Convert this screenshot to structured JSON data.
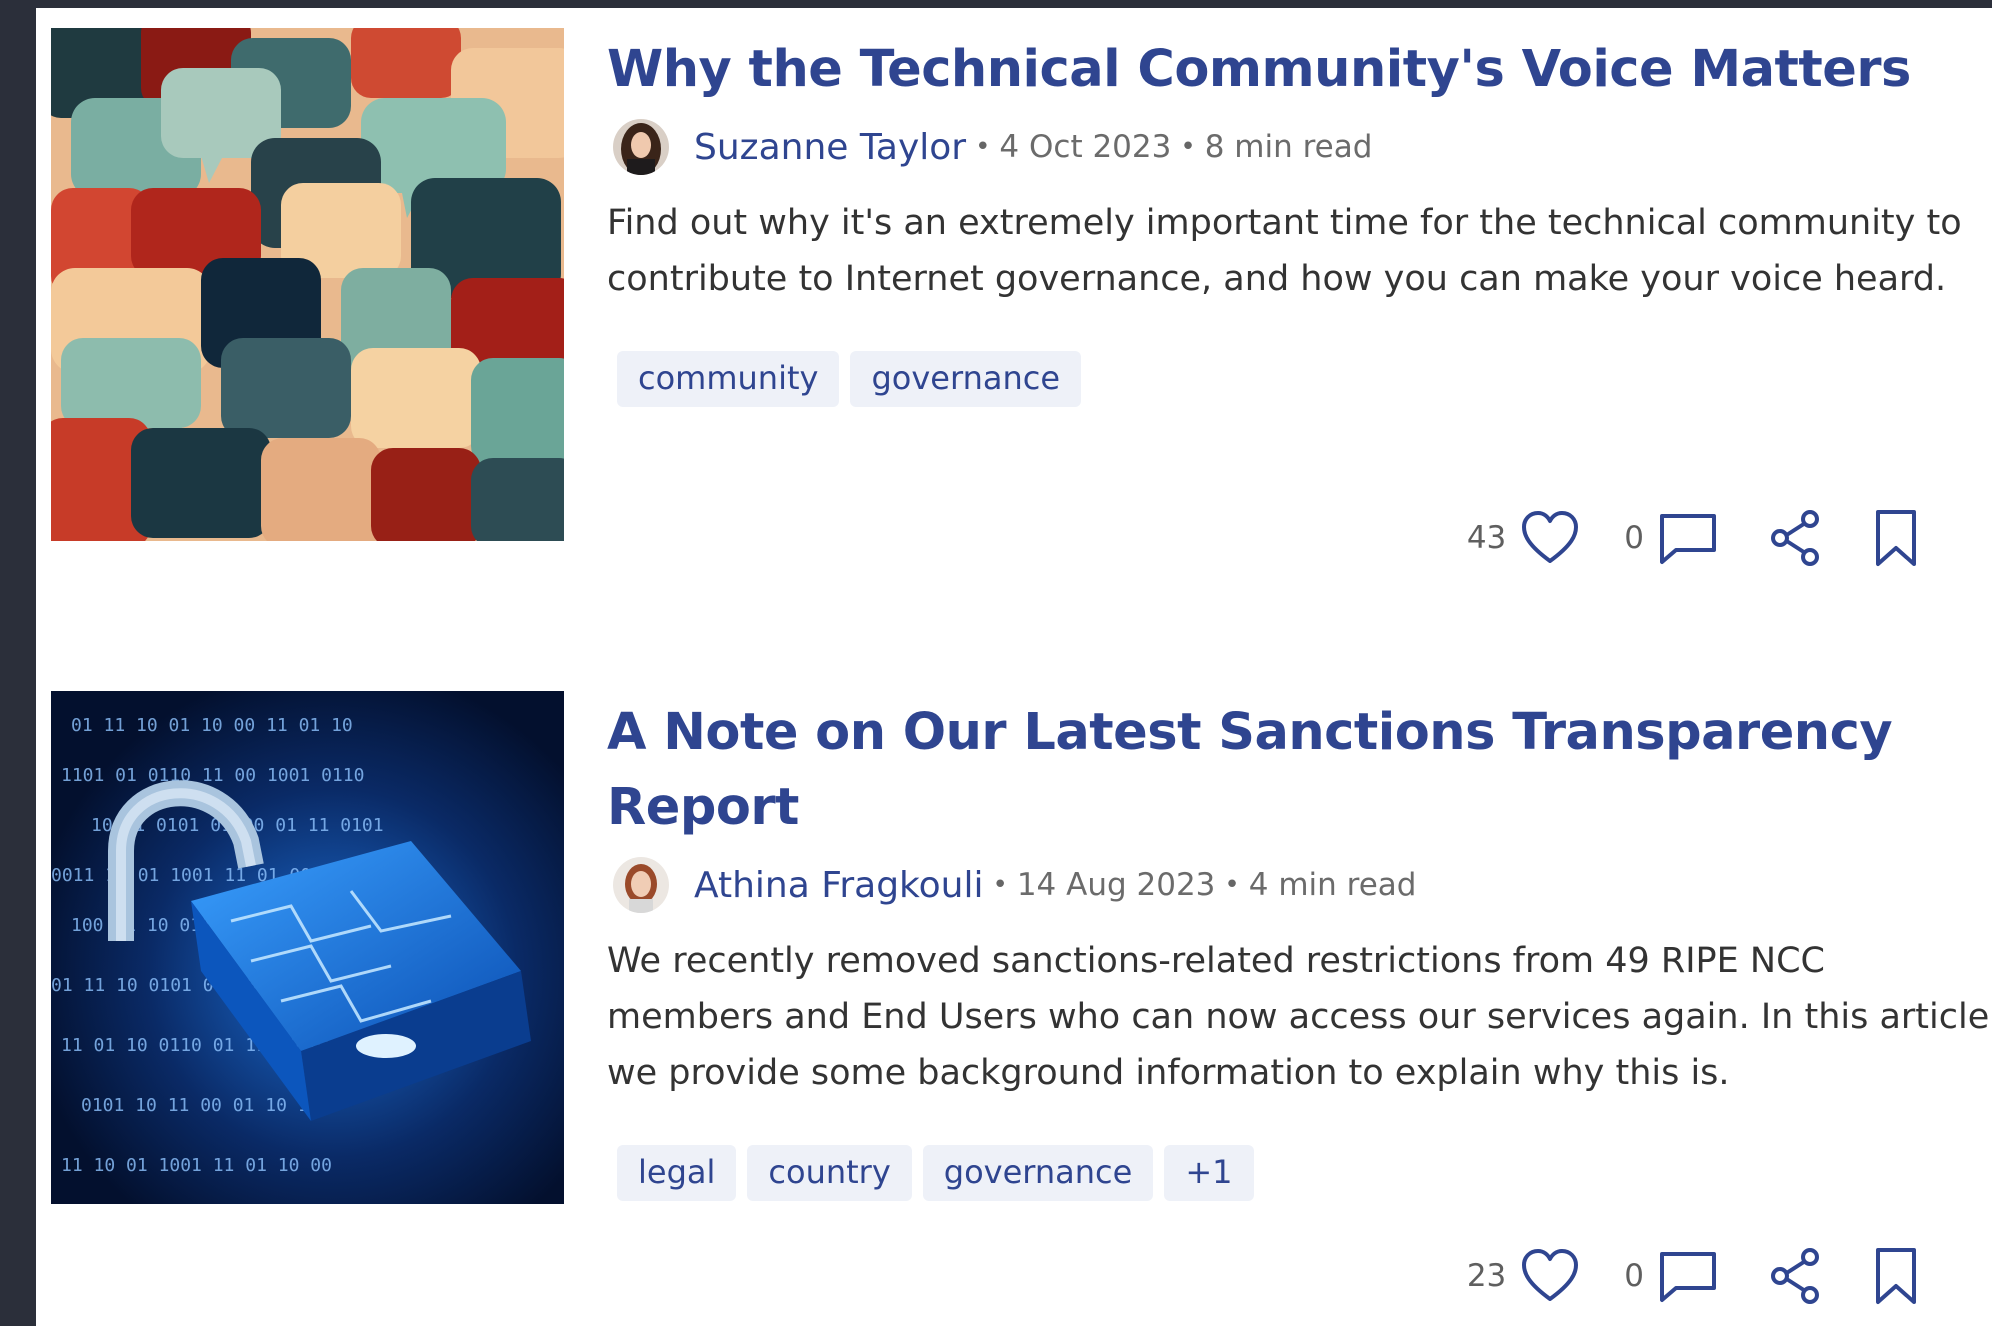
{
  "articles": [
    {
      "title": "Why the Technical Community's Voice Matters",
      "author": "Suzanne Taylor",
      "date": "4 Oct 2023",
      "read_time": "8 min read",
      "separator": "•",
      "description": "Find out why it's an extremely important time for the technical community to contribute to Internet governance, and how you can make your voice heard.",
      "tags": [
        "community",
        "governance"
      ],
      "likes": "43",
      "comments": "0",
      "image": "speech-bubbles-illustration",
      "avatar": "woman-dark-hair-portrait"
    },
    {
      "title": "A Note on Our Latest Sanctions Transparency Report",
      "author": "Athina Fragkouli",
      "date": "14 Aug 2023",
      "read_time": "4 min read",
      "separator": "•",
      "description": "We recently removed sanctions-related restrictions from 49 RIPE NCC members and End Users who can now access our services again. In this article we provide some background information to explain why this is.",
      "tags": [
        "legal",
        "country",
        "governance",
        "+1"
      ],
      "likes": "23",
      "comments": "0",
      "image": "digital-padlock-binary",
      "avatar": "woman-auburn-hair-portrait"
    }
  ],
  "icons": {
    "like": "heart-icon",
    "comment": "comment-icon",
    "share": "share-icon",
    "bookmark": "bookmark-icon"
  },
  "colors": {
    "accent": "#2f4590",
    "tag_bg": "#eef1f8",
    "frame": "#2b2f3a"
  }
}
